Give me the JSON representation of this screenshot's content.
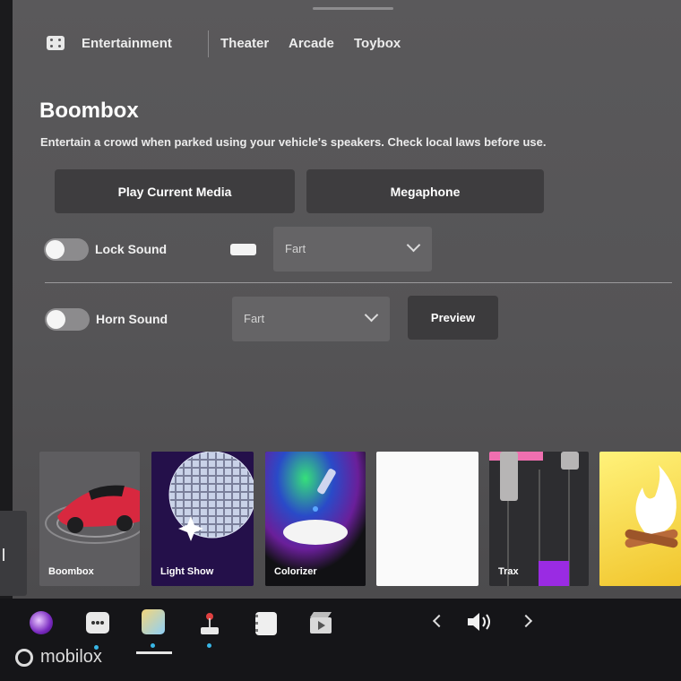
{
  "nav": {
    "section": "Entertainment",
    "tabs": [
      "Theater",
      "Arcade",
      "Toybox"
    ]
  },
  "boombox": {
    "title": "Boombox",
    "description": "Entertain a crowd when parked using your vehicle's speakers. Check local laws before use.",
    "play_media_label": "Play Current Media",
    "megaphone_label": "Megaphone",
    "lock_sound": {
      "label": "Lock Sound",
      "selected": "Fart",
      "enabled": false
    },
    "horn_sound": {
      "label": "Horn Sound",
      "selected": "Fart",
      "enabled": false
    },
    "preview_label": "Preview"
  },
  "tiles": [
    {
      "label": "Boombox"
    },
    {
      "label": "Light Show"
    },
    {
      "label": "Colorizer"
    },
    {
      "label": ""
    },
    {
      "label": "Trax"
    }
  ],
  "dock": {
    "icons": [
      "orb-icon",
      "more-icon",
      "toybox-icon",
      "arcade-joystick-icon",
      "notepad-icon",
      "theater-icon"
    ],
    "volume_icon": "speaker-icon"
  },
  "watermark": "mobilox",
  "colors": {
    "accent": "#38b6e6",
    "panel": "#5a595b",
    "button": "#3e3d3f",
    "trax_purple": "#9a2be3",
    "trax_pink": "#f06fb0"
  }
}
